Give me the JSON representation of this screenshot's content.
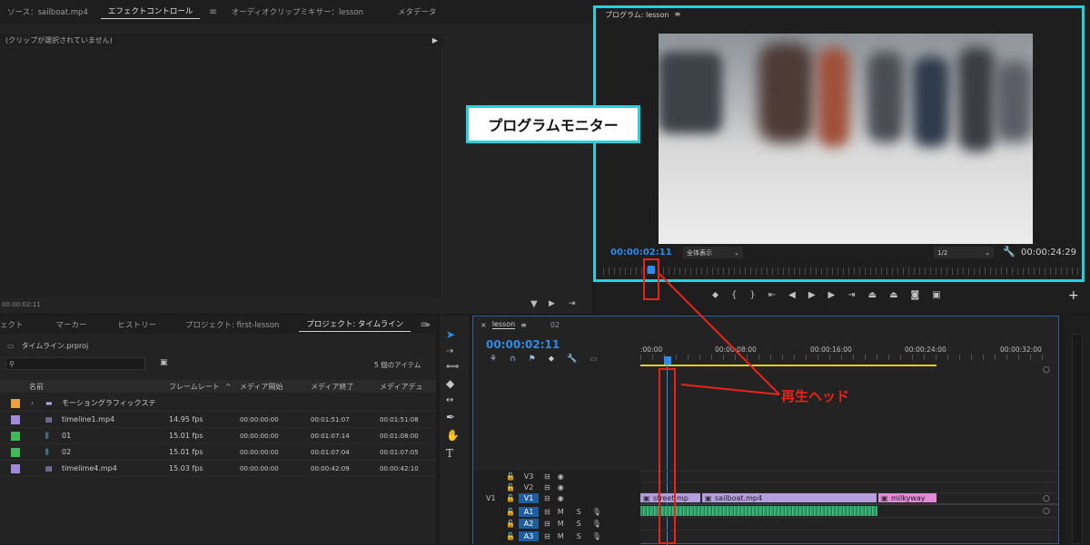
{
  "source_panel": {
    "tabs": [
      "ソース：sailboat.mp4",
      "エフェクトコントロール",
      "オーディオクリップミキサー：lesson",
      "メタデータ"
    ],
    "active_tab": "エフェクトコントロール",
    "no_clip_msg": "(クリップが選択されていません)",
    "timecode": "00:00:02:11"
  },
  "program_monitor": {
    "title": "プログラム: lesson",
    "timecode_current": "00:00:02:11",
    "fit_label": "全体表示",
    "resolution": "1/2",
    "timecode_duration": "00:00:24:29"
  },
  "project_panel": {
    "tabs": [
      "ェクト",
      "マーカー",
      "ヒストリー",
      "プロジェクト: first-lesson",
      "プロジェクト: タイムライン"
    ],
    "active_tab": "プロジェクト: タイムライン",
    "project_file": "タイムライン.prproj",
    "search_placeholder": "",
    "item_count": "5 個のアイテム",
    "columns": [
      "名前",
      "フレームレート",
      "メディア開始",
      "メディア終了",
      "メディアデュ"
    ],
    "rows": [
      {
        "color": "#e8a33a",
        "type": "folder",
        "name": "モーショングラフィックステ",
        "fps": "",
        "start": "",
        "end": "",
        "dur": ""
      },
      {
        "color": "#a18ad7",
        "type": "video",
        "name": "timeline1.mp4",
        "fps": "14.95 fps",
        "start": "00:00:00:00",
        "end": "00:01:51:07",
        "dur": "00:01:51:08"
      },
      {
        "color": "#41b85a",
        "type": "seq",
        "name": "01",
        "fps": "15.01 fps",
        "start": "00:00:00:00",
        "end": "00:01:07:14",
        "dur": "00:01:08:00"
      },
      {
        "color": "#41b85a",
        "type": "seq",
        "name": "02",
        "fps": "15.01 fps",
        "start": "00:00:00:00",
        "end": "00:01:07:04",
        "dur": "00:01:07:05"
      },
      {
        "color": "#a18ad7",
        "type": "video",
        "name": "timelime4.mp4",
        "fps": "15.03 fps",
        "start": "00:00:00:00",
        "end": "00:00:42:09",
        "dur": "00:00:42:10"
      }
    ]
  },
  "timeline": {
    "tabs": [
      "lesson",
      "02"
    ],
    "timecode": "00:00:02:11",
    "ruler": [
      ":00:00",
      "00:00:08:00",
      "00:00:16:00",
      "00:00:24:00",
      "00:00:32:00"
    ],
    "video_tracks": [
      "V3",
      "V2",
      "V1"
    ],
    "audio_tracks": [
      "A1",
      "A2",
      "A3"
    ],
    "source_patch": "V1",
    "track_m": "M",
    "track_s": "S",
    "clips": [
      {
        "name": "street.mp",
        "color": "#b49ee0"
      },
      {
        "name": "sailboat.mp4",
        "color": "#b49ee0"
      },
      {
        "name": "milkyway",
        "color": "#e389d8"
      }
    ]
  },
  "annotations": {
    "program_monitor_label": "プログラムモニター",
    "playhead_label": "再生ヘッド"
  },
  "colors": {
    "highlight": "#22d3dd",
    "annotation_red": "#e8231c",
    "timecode_blue": "#2d8ceb"
  }
}
